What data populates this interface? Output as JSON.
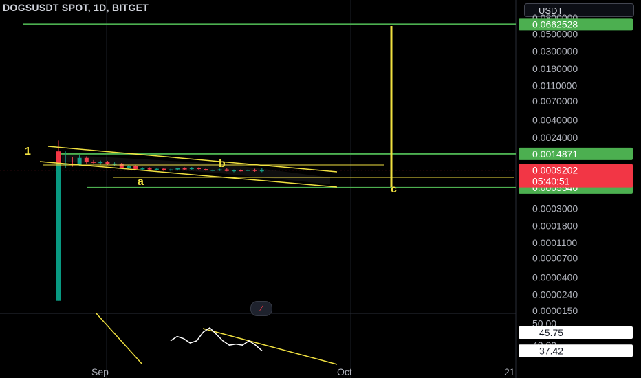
{
  "header": {
    "title": "DOGSUSDT SPOT, 1D, BITGET",
    "currency": "USDT"
  },
  "toolbar": {
    "collapse_icon": "slash-icon"
  },
  "colors": {
    "up": "#089981",
    "down": "#f23645",
    "trendline": "#f0e040",
    "level": "#4caf50",
    "oscillator": "#ffffff"
  },
  "chart_data": [
    {
      "type": "candlestick",
      "scale": "log",
      "ylim": [
        1.5e-05,
        0.08
      ],
      "yticks": [
        "0.0800000",
        "0.0500000",
        "0.0300000",
        "0.0180000",
        "0.0110000",
        "0.0070000",
        "0.0040000",
        "0.0024000",
        "0.0003000",
        "0.0001800",
        "0.0001100",
        "0.0000700",
        "0.0000400",
        "0.0000240",
        "0.0000150"
      ],
      "xticks": [
        "Sep",
        "Oct",
        "21"
      ],
      "horizontal_levels": [
        {
          "label": "0.0662528",
          "value": 0.0662528
        },
        {
          "label": "0.0014871",
          "value": 0.0014871
        },
        {
          "label": "0.0005540",
          "value": 0.000554
        }
      ],
      "last_price": {
        "label": "0.0009202",
        "value": 0.0009202,
        "countdown": "05:40:51"
      },
      "wave_labels": [
        "1",
        "a",
        "b",
        "c"
      ],
      "candles": [
        {
          "o": 0.0016,
          "h": 0.0022,
          "l": 2e-05,
          "c": 0.0011
        },
        {
          "o": 0.0011,
          "h": 0.0016,
          "l": 0.00098,
          "c": 0.00112
        },
        {
          "o": 0.00112,
          "h": 0.00135,
          "l": 0.00102,
          "c": 0.00108
        },
        {
          "o": 0.00108,
          "h": 0.00145,
          "l": 0.00104,
          "c": 0.00132
        },
        {
          "o": 0.00132,
          "h": 0.00138,
          "l": 0.00112,
          "c": 0.00118
        },
        {
          "o": 0.00118,
          "h": 0.00124,
          "l": 0.00112,
          "c": 0.00115
        },
        {
          "o": 0.00115,
          "h": 0.00122,
          "l": 0.00108,
          "c": 0.00117
        },
        {
          "o": 0.00117,
          "h": 0.00121,
          "l": 0.00107,
          "c": 0.0011
        },
        {
          "o": 0.0011,
          "h": 0.00116,
          "l": 0.00104,
          "c": 0.00112
        },
        {
          "o": 0.00112,
          "h": 0.00114,
          "l": 0.00096,
          "c": 0.00099
        },
        {
          "o": 0.00099,
          "h": 0.00108,
          "l": 0.00095,
          "c": 0.00104
        },
        {
          "o": 0.00104,
          "h": 0.00106,
          "l": 0.00093,
          "c": 0.00095
        },
        {
          "o": 0.00095,
          "h": 0.001,
          "l": 0.00091,
          "c": 0.00097
        },
        {
          "o": 0.00097,
          "h": 0.001,
          "l": 0.00092,
          "c": 0.00094
        },
        {
          "o": 0.00094,
          "h": 0.00098,
          "l": 0.00091,
          "c": 0.00096
        },
        {
          "o": 0.00096,
          "h": 0.00099,
          "l": 0.0009,
          "c": 0.00092
        },
        {
          "o": 0.00092,
          "h": 0.00096,
          "l": 0.00089,
          "c": 0.00094
        },
        {
          "o": 0.00094,
          "h": 0.00099,
          "l": 0.00091,
          "c": 0.00097
        },
        {
          "o": 0.00097,
          "h": 0.001,
          "l": 0.00093,
          "c": 0.00095
        },
        {
          "o": 0.00095,
          "h": 0.00101,
          "l": 0.00092,
          "c": 0.00098
        },
        {
          "o": 0.00098,
          "h": 0.001,
          "l": 0.00093,
          "c": 0.00095
        },
        {
          "o": 0.00095,
          "h": 0.00098,
          "l": 0.0009,
          "c": 0.00092
        },
        {
          "o": 0.00092,
          "h": 0.00095,
          "l": 0.00088,
          "c": 0.00093
        },
        {
          "o": 0.00093,
          "h": 0.00096,
          "l": 0.0009,
          "c": 0.00094
        },
        {
          "o": 0.00094,
          "h": 0.00097,
          "l": 0.00089,
          "c": 0.0009
        },
        {
          "o": 0.0009,
          "h": 0.00094,
          "l": 0.00087,
          "c": 0.00092
        },
        {
          "o": 0.00092,
          "h": 0.00095,
          "l": 0.00088,
          "c": 0.00091
        },
        {
          "o": 0.00091,
          "h": 0.00095,
          "l": 0.00089,
          "c": 0.00093
        },
        {
          "o": 0.00093,
          "h": 0.00096,
          "l": 0.00088,
          "c": 0.0009
        },
        {
          "o": 0.0009,
          "h": 0.00098,
          "l": 0.00087,
          "c": 0.00092
        }
      ]
    },
    {
      "type": "line",
      "yticks": [
        "50.00",
        "40.00"
      ],
      "markers": [
        {
          "label": "45.75",
          "value": 45.75
        },
        {
          "label": "37.42",
          "value": 37.42
        }
      ],
      "values": [
        42,
        44,
        43,
        41,
        42,
        46,
        48,
        45,
        42,
        40,
        40.5,
        40,
        42,
        40,
        37.4
      ]
    }
  ]
}
